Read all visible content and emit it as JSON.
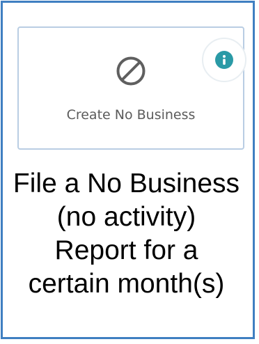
{
  "card": {
    "label": "Create No Business",
    "icon": "prohibited-icon",
    "info_icon": "info-icon",
    "info_color": "#2a9aa6"
  },
  "description": {
    "lines": [
      "File a No Business",
      "(no activity)",
      "Report for a",
      "certain month(s)"
    ]
  },
  "colors": {
    "frame_border": "#3f7fc1",
    "card_border": "#b9cde3"
  }
}
